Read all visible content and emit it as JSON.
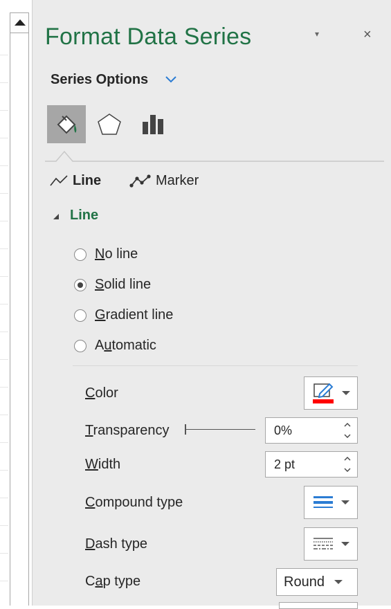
{
  "pane": {
    "title": "Format Data Series",
    "dropdown_glyph": "▾",
    "close_glyph": "×",
    "section_selector": "Series Options"
  },
  "icon_tabs": [
    {
      "name": "fill-line-icon",
      "active": true
    },
    {
      "name": "effects-icon",
      "active": false
    },
    {
      "name": "series-options-icon",
      "active": false
    }
  ],
  "subtabs": {
    "line": "Line",
    "marker": "Marker"
  },
  "line_section": {
    "heading": "Line",
    "options": [
      {
        "prefix": "",
        "key": "N",
        "rest": "o line",
        "checked": false
      },
      {
        "prefix": "",
        "key": "S",
        "rest": "olid line",
        "checked": true
      },
      {
        "prefix": "",
        "key": "G",
        "rest": "radient line",
        "checked": false
      },
      {
        "prefix": "A",
        "key": "u",
        "rest": "tomatic",
        "checked": false
      }
    ]
  },
  "properties": {
    "color": {
      "key": "C",
      "rest": "olor",
      "swatch": "#ff0000"
    },
    "transparency": {
      "key": "T",
      "rest": "ransparency",
      "value": "0%"
    },
    "width": {
      "key": "W",
      "rest": "idth",
      "value": "2 pt"
    },
    "compound": {
      "key": "C",
      "rest": "ompound type"
    },
    "dash": {
      "key": "D",
      "rest": "ash type"
    },
    "cap": {
      "prefix": "C",
      "key": "a",
      "rest": "p type",
      "value": "Round"
    }
  },
  "colors": {
    "accent_green": "#217346",
    "accent_blue": "#2b7cd3",
    "pane_bg": "#ebebeb"
  }
}
